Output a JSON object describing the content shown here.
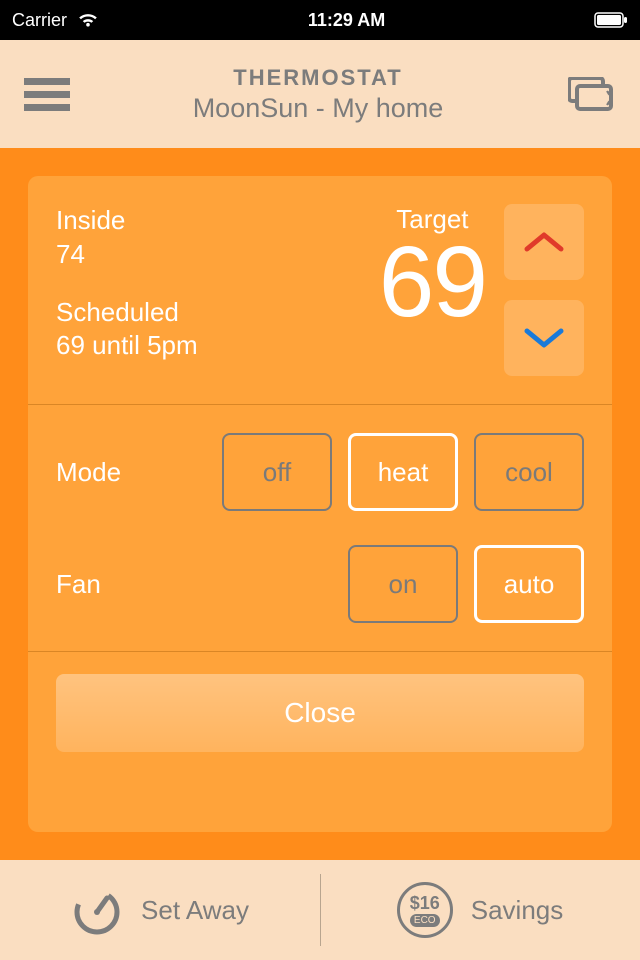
{
  "status_bar": {
    "carrier": "Carrier",
    "time": "11:29 AM"
  },
  "header": {
    "title": "THERMOSTAT",
    "subtitle": "MoonSun - My home"
  },
  "temperature": {
    "inside_label": "Inside",
    "inside_value": "74",
    "scheduled_label": "Scheduled",
    "scheduled_value": "69 until 5pm",
    "target_label": "Target",
    "target_value": "69"
  },
  "controls": {
    "mode": {
      "label": "Mode",
      "options": [
        "off",
        "heat",
        "cool"
      ],
      "selected": "heat"
    },
    "fan": {
      "label": "Fan",
      "options": [
        "on",
        "auto"
      ],
      "selected": "auto"
    }
  },
  "close_label": "Close",
  "bottom": {
    "set_away": "Set Away",
    "savings_label": "Savings",
    "savings_amount": "$16",
    "savings_badge": "ECO"
  }
}
